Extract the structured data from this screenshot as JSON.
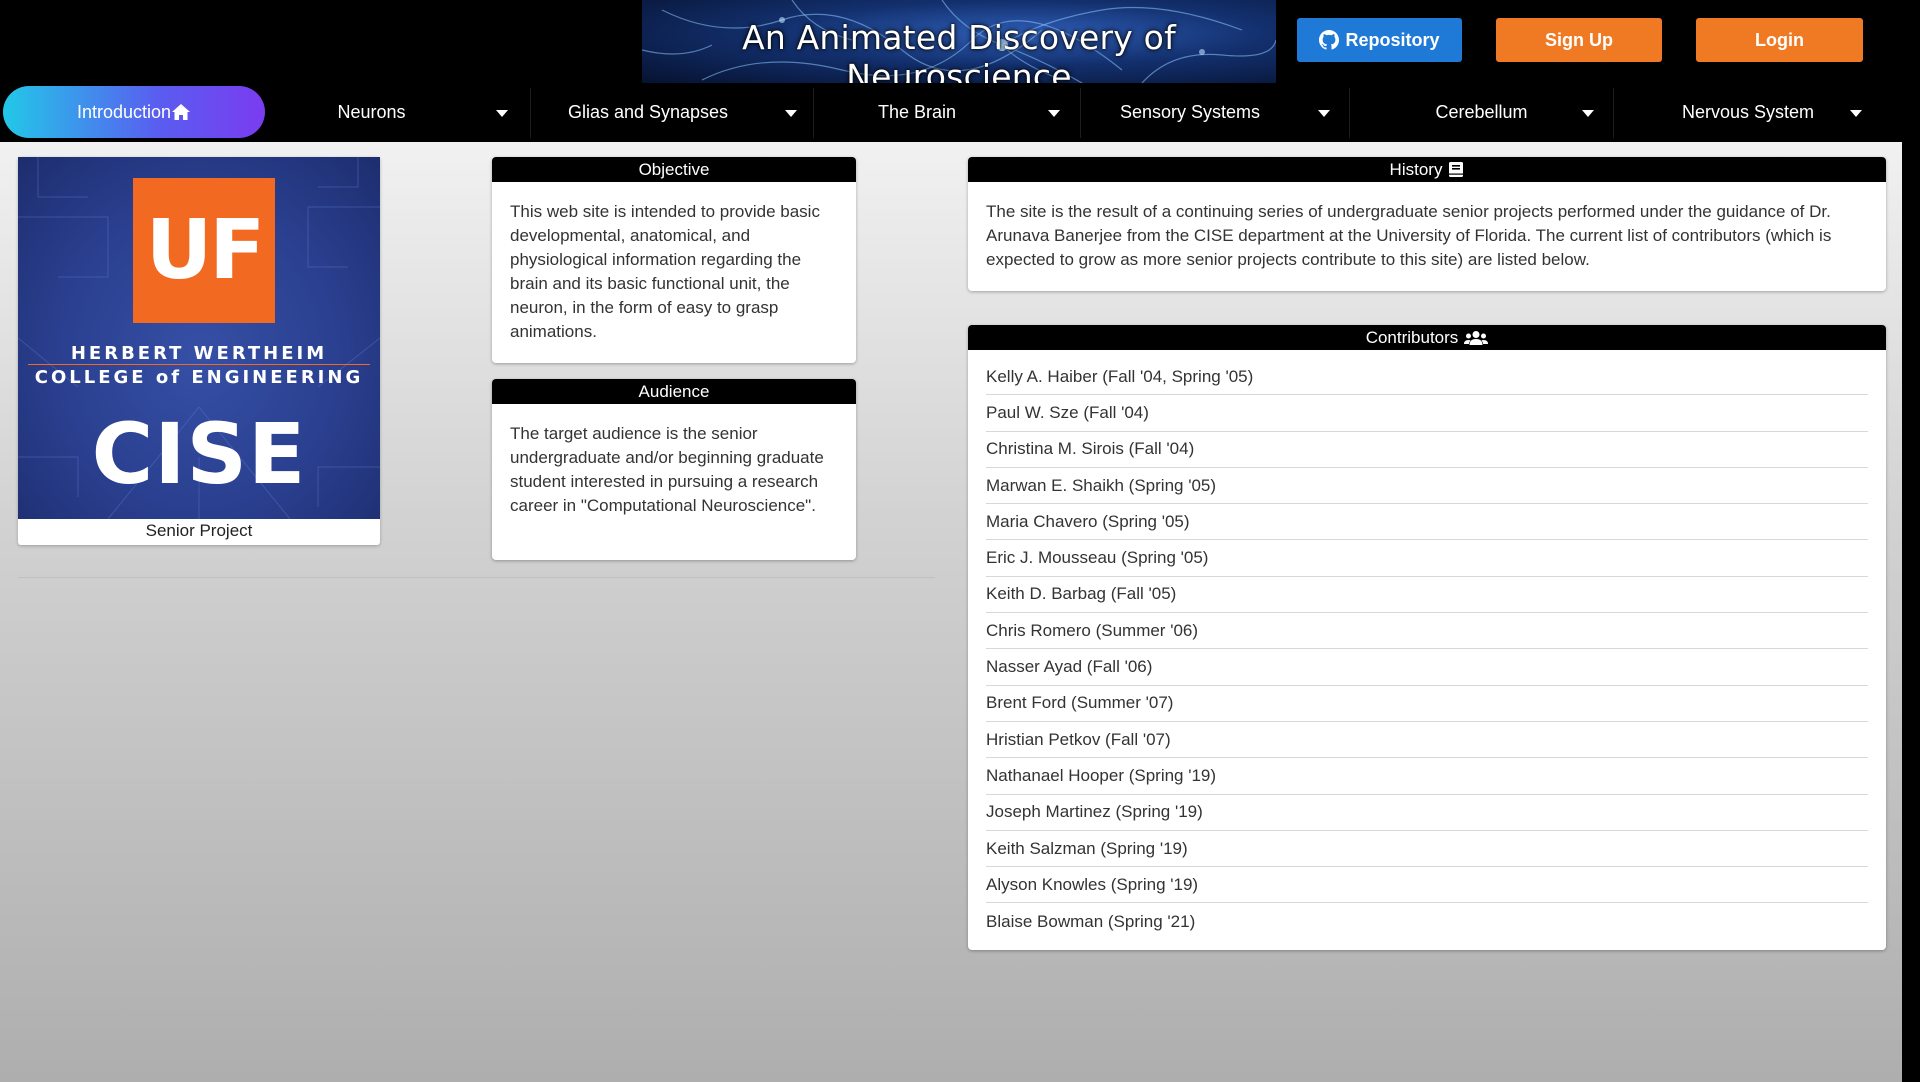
{
  "header": {
    "banner_title": "An Animated Discovery of Neuroscience",
    "buttons": {
      "repository": "Repository",
      "signup": "Sign Up",
      "login": "Login"
    },
    "colors": {
      "repository": "#1f79d6",
      "signup": "#f07a24",
      "login": "#f07a24"
    }
  },
  "nav": {
    "items": [
      {
        "label": "Introduction",
        "icon": "home-icon",
        "active": true
      },
      {
        "label": "Neurons",
        "dropdown": true
      },
      {
        "label": "Glias and Synapses",
        "dropdown": true
      },
      {
        "label": "The Brain",
        "dropdown": true
      },
      {
        "label": "Sensory Systems",
        "dropdown": true
      },
      {
        "label": "Cerebellum",
        "dropdown": true
      },
      {
        "label": "Nervous System",
        "dropdown": true
      }
    ]
  },
  "logo": {
    "uf": "UF",
    "line1": "HERBERT WERTHEIM",
    "line2": "COLLEGE of ENGINEERING",
    "cise": "CISE",
    "caption": "Senior Project"
  },
  "objective": {
    "title": "Objective",
    "text": "This web site is intended to provide basic developmental, anatomical, and physiological information regarding the brain and its basic functional unit, the neuron, in the form of easy to grasp animations."
  },
  "audience": {
    "title": "Audience",
    "text": "The target audience is the senior undergraduate and/or beginning graduate student interested in pursuing a research career in \"Computational Neuroscience\"."
  },
  "history": {
    "title": "History",
    "icon": "book-icon",
    "text": "The site is the result of a continuing series of undergraduate senior projects performed under the guidance of Dr. Arunava Banerjee from the CISE department at the University of Florida. The current list of contributors (which is expected to grow as more senior projects contribute to this site) are listed below."
  },
  "contributors": {
    "title": "Contributors",
    "icon": "users-icon",
    "list": [
      "Kelly A. Haiber (Fall '04, Spring '05)",
      "Paul W. Sze (Fall '04)",
      "Christina M. Sirois (Fall '04)",
      "Marwan E. Shaikh (Spring '05)",
      "Maria Chavero (Spring '05)",
      "Eric J. Mousseau (Spring '05)",
      "Keith D. Barbag (Fall '05)",
      "Chris Romero (Summer '06)",
      "Nasser Ayad (Fall '06)",
      "Brent Ford (Summer '07)",
      "Hristian Petkov (Fall '07)",
      "Nathanael Hooper (Spring '19)",
      "Joseph Martinez (Spring '19)",
      "Keith Salzman (Spring '19)",
      "Alyson Knowles (Spring '19)",
      "Blaise Bowman (Spring '21)"
    ]
  }
}
